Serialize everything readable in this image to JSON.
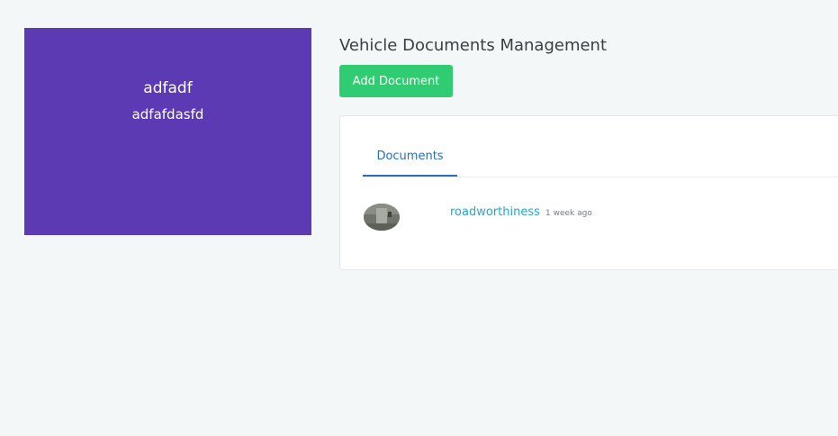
{
  "profile": {
    "name": "adfadf",
    "subtitle": "adfafdasfd"
  },
  "header": {
    "title": "Vehicle Documents Management",
    "add_button_label": "Add Document"
  },
  "tabs": [
    {
      "label": "Documents",
      "active": true
    }
  ],
  "documents": [
    {
      "name": "roadworthiness",
      "time": "1 week ago",
      "thumbnail_icon": "document-photo-thumbnail"
    }
  ],
  "colors": {
    "profile_bg": "#5c3ab3",
    "add_button": "#2fcc71",
    "tab_active": "#2a6ebd",
    "link": "#2aa5c9",
    "page_bg": "#f4f7f7"
  }
}
